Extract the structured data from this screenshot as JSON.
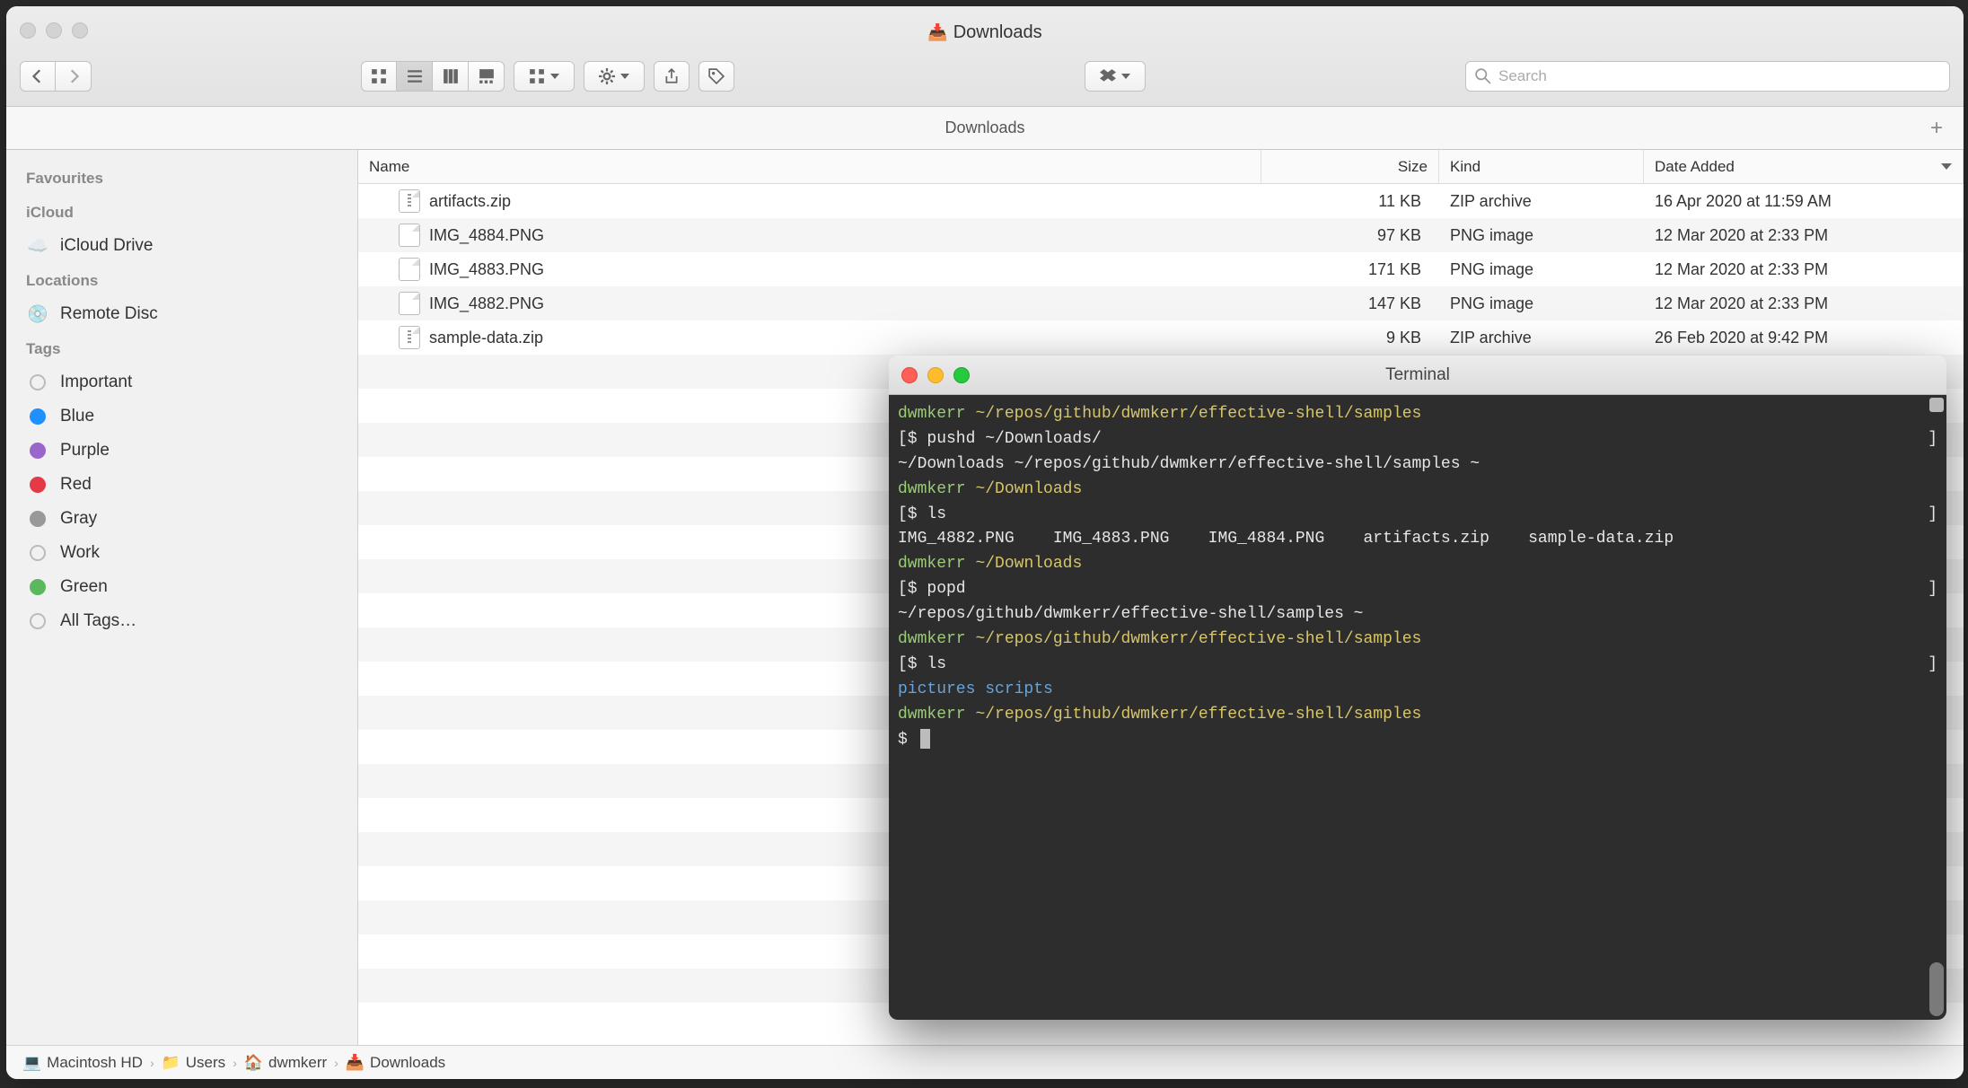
{
  "finder": {
    "window_title": "Downloads",
    "search_placeholder": "Search",
    "tab_title": "Downloads",
    "sidebar": {
      "favourites": {
        "heading": "Favourites"
      },
      "icloud": {
        "heading": "iCloud",
        "drive": "iCloud Drive"
      },
      "locations": {
        "heading": "Locations",
        "remote_disc": "Remote Disc"
      },
      "tags": {
        "heading": "Tags",
        "items": [
          {
            "label": "Important",
            "class": "important"
          },
          {
            "label": "Blue",
            "class": "blue"
          },
          {
            "label": "Purple",
            "class": "purple"
          },
          {
            "label": "Red",
            "class": "red"
          },
          {
            "label": "Gray",
            "class": "gray"
          },
          {
            "label": "Work",
            "class": "work"
          },
          {
            "label": "Green",
            "class": "green"
          },
          {
            "label": "All Tags…",
            "class": "all"
          }
        ]
      }
    },
    "columns": {
      "name": "Name",
      "size": "Size",
      "kind": "Kind",
      "date": "Date Added"
    },
    "files": [
      {
        "name": "artifacts.zip",
        "size": "11 KB",
        "kind": "ZIP archive",
        "date": "16 Apr 2020 at 11:59 AM",
        "icon": "zip"
      },
      {
        "name": "IMG_4884.PNG",
        "size": "97 KB",
        "kind": "PNG image",
        "date": "12 Mar 2020 at 2:33 PM",
        "icon": "png"
      },
      {
        "name": "IMG_4883.PNG",
        "size": "171 KB",
        "kind": "PNG image",
        "date": "12 Mar 2020 at 2:33 PM",
        "icon": "png"
      },
      {
        "name": "IMG_4882.PNG",
        "size": "147 KB",
        "kind": "PNG image",
        "date": "12 Mar 2020 at 2:33 PM",
        "icon": "png"
      },
      {
        "name": "sample-data.zip",
        "size": "9 KB",
        "kind": "ZIP archive",
        "date": "26 Feb 2020 at 9:42 PM",
        "icon": "zip"
      }
    ],
    "path": [
      {
        "icon": "💻",
        "label": "Macintosh HD"
      },
      {
        "icon": "📁",
        "label": "Users"
      },
      {
        "icon": "🏠",
        "label": "dwmkerr"
      },
      {
        "icon": "📥",
        "label": "Downloads"
      }
    ]
  },
  "terminal": {
    "title": "Terminal",
    "prompts": {
      "user": "dwmkerr",
      "p1": "~/repos/github/dwmkerr/effective-shell/samples",
      "p2": "~/Downloads"
    },
    "cmds": {
      "pushd": "pushd ~/Downloads/",
      "ls1": "ls",
      "popd": "popd",
      "ls2": "ls"
    },
    "out": {
      "stack1": "~/Downloads ~/repos/github/dwmkerr/effective-shell/samples ~",
      "ls_files": "IMG_4882.PNG    IMG_4883.PNG    IMG_4884.PNG    artifacts.zip    sample-data.zip",
      "stack2": "~/repos/github/dwmkerr/effective-shell/samples ~",
      "dirs": "pictures scripts"
    }
  }
}
